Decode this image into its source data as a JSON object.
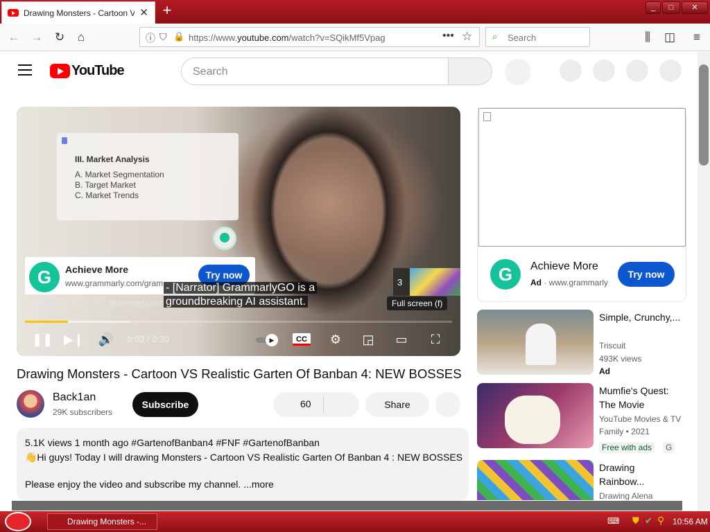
{
  "browser": {
    "tab_title": "Drawing Monsters - Cartoon VS Realistic Garten Of Banban 4: NEW BOSSES",
    "url_prefix": "https://www.",
    "url_domain": "youtube.com",
    "url_path": "/watch?v=SQikMf5Vpag",
    "search_placeholder": "Search",
    "window_buttons": [
      "_",
      "□",
      "✕"
    ]
  },
  "youtube": {
    "logo_text": "YouTube",
    "search_placeholder": "Search"
  },
  "player": {
    "slide_title": "III. Market Analysis",
    "slide_items": [
      "A. Market Segmentation",
      "B. Target Market",
      "C. Market Trends"
    ],
    "ad_title": "Achieve More",
    "ad_url": "www.grammarly.com/gram",
    "ad_button": "Try now",
    "ad_info": "Ad 2 of 2 · 0:27",
    "ad_domain": "grammarly.com",
    "caption_line1": "- [Narrator] GrammarlyGO is a",
    "caption_line2": "groundbreaking AI assistant.",
    "skip_count": "3",
    "tooltip": "Full screen (f)",
    "time": "0:03 / 0:30",
    "progress_fraction": 0.1,
    "cc_label": "CC"
  },
  "video": {
    "title": "Drawing Monsters - Cartoon VS Realistic Garten Of Banban 4: NEW BOSSES",
    "channel_name": "Back1an",
    "channel_subs": "29K subscribers",
    "subscribe_label": "Subscribe",
    "like_count": "60",
    "share_label": "Share",
    "description_meta": "5.1K views  1 month ago  #GartenofBanban4 #FNF #GartenofBanban",
    "description_line1": "👋Hi guys! Today I will drawing Monsters - Cartoon VS Realistic Garten Of Banban 4 : NEW BOSSES",
    "description_line2": "Please enjoy the video and subscribe my channel.",
    "more_label": "...more"
  },
  "sidebar": {
    "ad_title": "Achieve More",
    "ad_label": "Ad",
    "ad_url": "www.grammarly",
    "ad_button": "Try now",
    "recommendations": [
      {
        "title": "Simple, Crunchy,...",
        "line1": "Triscuit",
        "line2": "493K views",
        "line3": "Ad"
      },
      {
        "title": "Mumfie's Quest: The Movie",
        "line1": "YouTube Movies & TV",
        "line2": "Family • 2021",
        "line3": "Free with ads",
        "badge": "G"
      },
      {
        "title": "Drawing Rainbow...",
        "line1": "Drawing Alena"
      }
    ]
  },
  "taskbar": {
    "item_label": "Drawing Monsters -...",
    "clock": "10:56 AM"
  },
  "colors": {
    "brand_red": "#ff0000",
    "grammarly_green": "#15c39a",
    "ad_blue": "#0b57d0",
    "progress_yellow": "#f8c600",
    "theme_red": "#b11c22"
  }
}
